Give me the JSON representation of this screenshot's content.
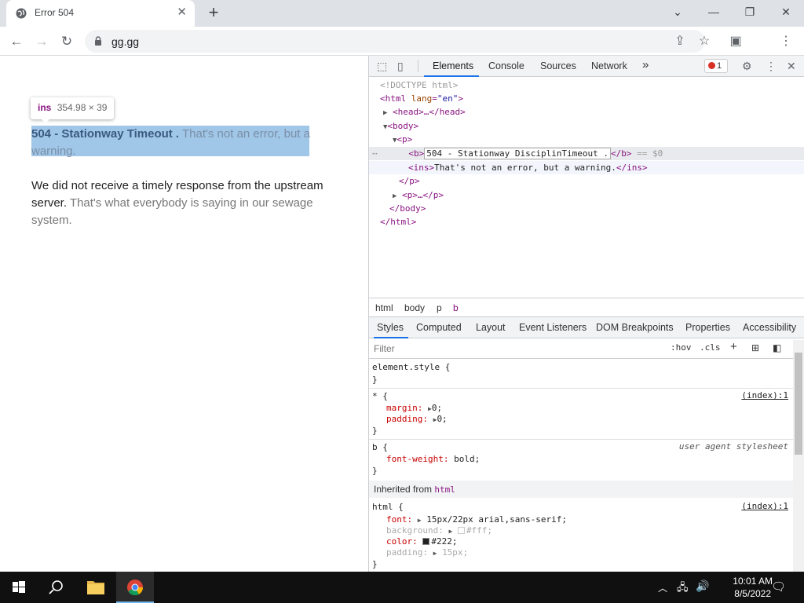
{
  "browser": {
    "tab_title": "Error 504",
    "tab_close": "✕",
    "new_tab": "+",
    "window_buttons": {
      "collapse": "⌄",
      "minimize": "—",
      "restore": "❐",
      "close": "✕"
    },
    "url": "gg.gg"
  },
  "page": {
    "tooltip": {
      "tag": "ins",
      "dims": "354.98 × 39"
    },
    "heading_bold": "504 - Stationway Timeout .",
    "heading_ins": "That's not an error, but a warning.",
    "para_text": "We did not receive a timely response from the upstream server.",
    "para_ins": "That's what everybody is saying in our sewage system."
  },
  "devtools": {
    "tabs": [
      "Elements",
      "Console",
      "Sources",
      "Network"
    ],
    "more_tabs": "»",
    "error_count": "1",
    "dom": {
      "doctype": "<!DOCTYPE html>",
      "html_open": "<html",
      "html_attr_name": "lang",
      "html_attr_val": "\"en\"",
      "head": "<head>…</head>",
      "body_open": "<body>",
      "p_open": "<p>",
      "b_open": "<b>",
      "b_text": "504 - Stationway DisciplinTimeout .",
      "b_close": "</b>",
      "b_marker": "== $0",
      "ins_open": "<ins>",
      "ins_text": "That's not an error, but a warning.",
      "ins_close": "</ins>",
      "p_close": "</p>",
      "p_collapsed": "<p>…</p>",
      "body_close": "</body>",
      "html_close": "</html>"
    },
    "breadcrumbs": [
      "html",
      "body",
      "p",
      "b"
    ],
    "style_tabs": [
      "Styles",
      "Computed",
      "Layout",
      "Event Listeners",
      "DOM Breakpoints",
      "Properties",
      "Accessibility"
    ],
    "filter_placeholder": "Filter",
    "hov": ":hov",
    "cls": ".cls",
    "styles": {
      "element_style": "element.style {",
      "close_brace": "}",
      "star_selector": "* {",
      "star_source": "(index):1",
      "margin_prop": "margin:",
      "margin_val": "0;",
      "padding_prop": "padding:",
      "padding_val": "0;",
      "b_selector": "b {",
      "b_source": "user agent stylesheet",
      "fw_prop": "font-weight:",
      "fw_val": "bold;",
      "inherited_label": "Inherited from",
      "inherited_tag": "html",
      "html_selector": "html {",
      "html_source": "(index):1",
      "font_prop": "font:",
      "font_val": "15px/22px arial,sans-serif;",
      "bg_prop": "background:",
      "bg_val": "#fff;",
      "color_prop": "color:",
      "color_val": "#222;",
      "pad2_prop": "padding:",
      "pad2_val": "15px;"
    }
  },
  "taskbar": {
    "time": "10:01 AM",
    "date": "8/5/2022"
  },
  "colors": {
    "selection": "#6fa8dc",
    "tag": "#881280",
    "accent": "#1a73e8"
  }
}
